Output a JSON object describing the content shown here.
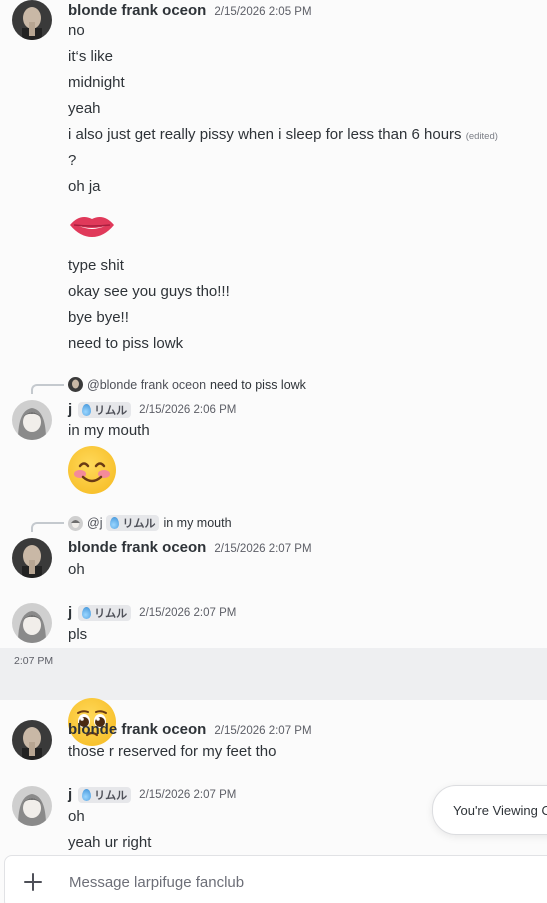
{
  "messages": {
    "m1": {
      "username": "blonde frank oceon",
      "timestamp": "2/15/2026 2:05 PM",
      "lines": [
        "no",
        "it‘s like",
        "midnight",
        "yeah",
        "i also just get really pissy when i sleep for less than 6 hours",
        "?",
        "oh ja",
        "type shit",
        "okay see you guys tho!!!",
        "bye bye!!",
        "need to piss lowk"
      ],
      "edited_label": "(edited)",
      "emoji": "biting-lip-emoji"
    },
    "m2": {
      "reply_mention": "@blonde frank oceon",
      "reply_text": "need to piss lowk",
      "username": "j",
      "tag": "リムル",
      "timestamp": "2/15/2026 2:06 PM",
      "text": "in my mouth",
      "emoji": "smiling-blush-emoji"
    },
    "m3": {
      "reply_mention": "@j",
      "reply_tag": "リムル",
      "reply_text": "in my mouth",
      "username": "blonde frank oceon",
      "timestamp": "2/15/2026 2:07 PM",
      "text": "oh"
    },
    "m4": {
      "username": "j",
      "tag": "リムル",
      "timestamp": "2/15/2026 2:07 PM",
      "text": "pls",
      "hover_time": "2:07 PM",
      "emoji": "pleading-face-emoji"
    },
    "m5": {
      "username": "blonde frank oceon",
      "timestamp": "2/15/2026 2:07 PM",
      "text": "those r reserved for my feet tho"
    },
    "m6": {
      "username": "j",
      "tag": "リムル",
      "timestamp": "2/15/2026 2:07 PM",
      "lines": [
        "oh",
        "yeah ur right"
      ]
    }
  },
  "toast": "You're Viewing O",
  "composer": {
    "placeholder": "Message larpifuge fanclub",
    "plus_icon": "plus-icon"
  },
  "colors": {
    "background": "#fbfbfb",
    "highlight_row": "#eeeff1",
    "text": "#2e3338",
    "timestamp": "#5c5e66"
  }
}
